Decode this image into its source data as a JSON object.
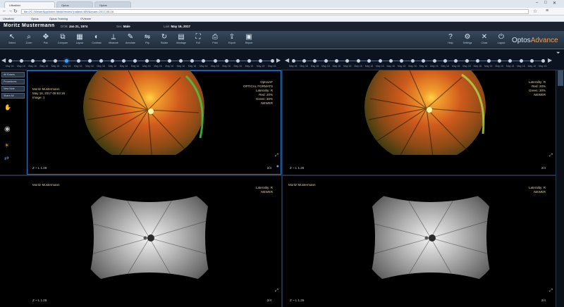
{
  "browser": {
    "tabs": [
      "Ultrafield",
      "Optos",
      "Optos"
    ],
    "url": "file:///C:/ViewerApp/index.html#/review?patient=MW&exam=2017-05-16",
    "bookmarks": [
      "Ultrafield",
      "Optos",
      "Optos Training",
      "OViewer"
    ]
  },
  "patient": {
    "name": "Moritz Mustermann",
    "fields": [
      {
        "key": "DOB",
        "value": "Jan 21, 1974"
      },
      {
        "key": "Sex",
        "value": "Male"
      },
      {
        "key": "Last",
        "value": "May 16, 2017"
      }
    ]
  },
  "toolbar": {
    "tools": [
      {
        "icon": "pointer-icon",
        "glyph": "↖",
        "label": "Select"
      },
      {
        "icon": "zoom-icon",
        "glyph": "⌕",
        "label": "Zoom"
      },
      {
        "icon": "pan-icon",
        "glyph": "✥",
        "label": "Pan"
      },
      {
        "icon": "compare-icon",
        "glyph": "⧉",
        "label": "Compare"
      },
      {
        "icon": "layout-icon",
        "glyph": "▦",
        "label": "Layout"
      },
      {
        "icon": "contrast-icon",
        "glyph": "◐",
        "label": "Contrast"
      },
      {
        "icon": "measure-icon",
        "glyph": "⟂",
        "label": "Measure"
      },
      {
        "icon": "annotate-icon",
        "glyph": "✎",
        "label": "Annotate"
      },
      {
        "icon": "flip-icon",
        "glyph": "⇋",
        "label": "Flip"
      },
      {
        "icon": "rotate-icon",
        "glyph": "↻",
        "label": "Rotate"
      },
      {
        "icon": "grid-icon",
        "glyph": "▤",
        "label": "Montage"
      },
      {
        "icon": "fullscreen-icon",
        "glyph": "⛶",
        "label": "Full"
      },
      {
        "icon": "print-icon",
        "glyph": "⎙",
        "label": "Print"
      },
      {
        "icon": "export-icon",
        "glyph": "⇪",
        "label": "Export"
      },
      {
        "icon": "report-icon",
        "glyph": "▣",
        "label": "Report"
      }
    ],
    "right_tools": [
      {
        "icon": "help-icon",
        "glyph": "?",
        "label": "Help"
      },
      {
        "icon": "settings-icon",
        "glyph": "⚙",
        "label": "Settings"
      },
      {
        "icon": "close-icon",
        "glyph": "✕",
        "label": "Close"
      },
      {
        "icon": "logout-icon",
        "glyph": "⏻",
        "label": "Logout"
      }
    ],
    "brand_main": "Optos",
    "brand_accent": "Advance"
  },
  "timeline": {
    "selected_index": 5,
    "dates_left": [
      "May 16",
      "May 16",
      "May 16",
      "May 16",
      "May 16",
      "May 16",
      "May 16",
      "May 16",
      "May 16",
      "May 16",
      "May 16",
      "May 16",
      "May 16",
      "May 16",
      "May 16",
      "May 16",
      "May 16",
      "May 16",
      "May 16",
      "May 16",
      "May 16",
      "May 16",
      "May 16",
      "May 16"
    ],
    "dates_right": [
      "May 16",
      "May 16",
      "May 16",
      "May 16",
      "May 16",
      "May 16",
      "May 16",
      "May 16",
      "May 16",
      "May 16",
      "May 16",
      "May 16",
      "May 16",
      "May 16",
      "May 16",
      "May 16",
      "May 16",
      "May 16",
      "May 16",
      "May 16",
      "May 16",
      "May 16",
      "May 16",
      "May 16"
    ]
  },
  "side_panel": {
    "buttons": [
      "All Exams",
      "Procedures",
      "New Note",
      "Share All"
    ]
  },
  "viewports": [
    {
      "type": "color",
      "name": "Moritz Mustermann",
      "meta": [
        "May 16, 2017 09:53:16",
        "Image: 1"
      ],
      "info": [
        "OptosAF",
        "OPTICAL FORMATS",
        "Laterality: R",
        "Red: 20%",
        "Green: 30%",
        "NEWER"
      ],
      "zoom": "Z ~ L 1.26",
      "corner": "2/4"
    },
    {
      "type": "color",
      "name": "",
      "meta": [],
      "info": [
        "Laterality: R",
        "Red: 20%",
        "Green: 30%",
        "NEWER"
      ],
      "zoom": "Z ~ L 1.26",
      "corner": "2/4"
    },
    {
      "type": "af",
      "name": "Moritz Mustermann",
      "meta": [],
      "info": [
        "Laterality: R",
        "NEWER"
      ],
      "zoom": "Z ~ L 1.26",
      "corner": "2/4"
    },
    {
      "type": "af",
      "name": "Moritz Mustermann",
      "meta": [],
      "info": [
        "Laterality: R",
        "NEWER"
      ],
      "zoom": "Z ~ L 1.26",
      "corner": "2/4"
    }
  ],
  "colors": {
    "accent": "#3fa6ff",
    "overlay_text": "#e6d78a",
    "brand_accent": "#ff9c3c",
    "toolbar_bg": "#2a3a4c"
  }
}
